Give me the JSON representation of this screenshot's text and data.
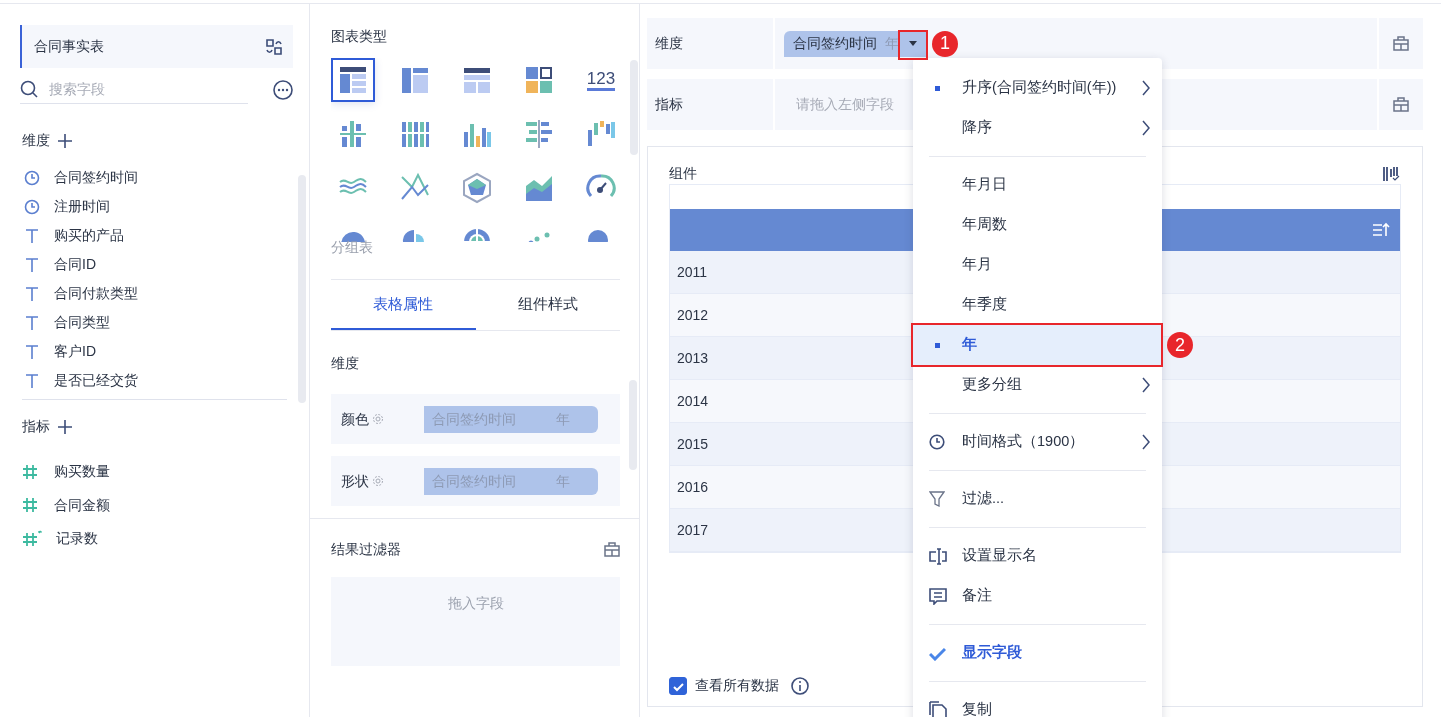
{
  "fields_panel": {
    "table_name": "合同事实表",
    "search": {
      "placeholder": "搜索字段"
    },
    "dimensions_title": "维度",
    "dimension_fields": [
      {
        "name": "合同签约时间",
        "kind": "time"
      },
      {
        "name": "注册时间",
        "kind": "time"
      },
      {
        "name": "购买的产品",
        "kind": "text"
      },
      {
        "name": "合同ID",
        "kind": "text"
      },
      {
        "name": "合同付款类型",
        "kind": "text"
      },
      {
        "name": "合同类型",
        "kind": "text"
      },
      {
        "name": "客户ID",
        "kind": "text"
      },
      {
        "name": "是否已经交货",
        "kind": "text"
      }
    ],
    "measures_title": "指标",
    "measure_fields": [
      {
        "name": "购买数量",
        "kind": "number"
      },
      {
        "name": "合同金额",
        "kind": "number"
      },
      {
        "name": "记录数",
        "kind": "count"
      }
    ]
  },
  "chart_panel": {
    "title": "图表类型",
    "chart_types": [
      {
        "kind": "grouped-table",
        "selected": true
      },
      {
        "kind": "cross-table",
        "selected": false
      },
      {
        "kind": "detail-table",
        "selected": false
      },
      {
        "kind": "tile-grid",
        "selected": false
      },
      {
        "kind": "number",
        "label": "123",
        "selected": false
      },
      {
        "kind": "grouped-bar",
        "selected": false
      },
      {
        "kind": "stacked-column",
        "selected": false
      },
      {
        "kind": "column",
        "selected": false
      },
      {
        "kind": "bar",
        "selected": false
      },
      {
        "kind": "waterfall",
        "selected": false
      },
      {
        "kind": "line",
        "selected": false
      },
      {
        "kind": "cross-line",
        "selected": false
      },
      {
        "kind": "radar",
        "selected": false
      },
      {
        "kind": "area",
        "selected": false
      },
      {
        "kind": "gauge",
        "selected": false
      },
      {
        "kind": "pie",
        "selected": false
      },
      {
        "kind": "rose",
        "selected": false
      },
      {
        "kind": "sunburst",
        "selected": false
      },
      {
        "kind": "scatter",
        "selected": false
      },
      {
        "kind": "bubble",
        "selected": false
      }
    ],
    "caption": "分组表",
    "tabs": [
      {
        "label": "表格属性",
        "selected": true
      },
      {
        "label": "组件样式",
        "selected": false
      }
    ],
    "section_title": "维度",
    "attributes": [
      {
        "label": "颜色",
        "field": "合同签约时间",
        "unit": "年"
      },
      {
        "label": "形状",
        "field": "合同签约时间",
        "unit": "年"
      }
    ],
    "filter": {
      "title": "结果过滤器",
      "placeholder": "拖入字段"
    }
  },
  "editor": {
    "dimension": {
      "label": "维度",
      "field": "合同签约时间",
      "unit": "年"
    },
    "indicator": {
      "label": "指标",
      "placeholder": "请拖入左侧字段"
    },
    "component": {
      "title": "组件",
      "rows": [
        "2011",
        "2012",
        "2013",
        "2014",
        "2015",
        "2016",
        "2017"
      ],
      "view_all": {
        "label": "查看所有数据",
        "checked": true
      }
    }
  },
  "menu": {
    "items": [
      {
        "kind": "plain",
        "label": "升序(合同签约时间(年))",
        "selected": true,
        "highlighted": false,
        "submenu": true
      },
      {
        "kind": "plain",
        "label": "降序",
        "selected": false,
        "highlighted": false,
        "submenu": true
      },
      {
        "kind": "divider"
      },
      {
        "kind": "plain",
        "label": "年月日",
        "selected": false,
        "highlighted": false,
        "submenu": false
      },
      {
        "kind": "plain",
        "label": "年周数",
        "selected": false,
        "highlighted": false,
        "submenu": false
      },
      {
        "kind": "plain",
        "label": "年月",
        "selected": false,
        "highlighted": false,
        "submenu": false
      },
      {
        "kind": "plain",
        "label": "年季度",
        "selected": false,
        "highlighted": false,
        "submenu": false
      },
      {
        "kind": "plain",
        "label": "年",
        "selected": true,
        "highlighted": true,
        "submenu": false
      },
      {
        "kind": "plain",
        "label": "更多分组",
        "selected": false,
        "highlighted": false,
        "submenu": true
      },
      {
        "kind": "divider"
      },
      {
        "kind": "clock",
        "label": "时间格式（1900）",
        "selected": false,
        "highlighted": false,
        "submenu": true
      },
      {
        "kind": "divider"
      },
      {
        "kind": "filter",
        "label": "过滤...",
        "selected": false,
        "highlighted": false,
        "submenu": false
      },
      {
        "kind": "divider"
      },
      {
        "kind": "rename",
        "label": "设置显示名",
        "selected": false,
        "highlighted": false,
        "submenu": false
      },
      {
        "kind": "note",
        "label": "备注",
        "selected": false,
        "highlighted": false,
        "submenu": false
      },
      {
        "kind": "divider"
      },
      {
        "kind": "plain",
        "label": "显示字段",
        "checked": true,
        "selected": false,
        "highlighted": false,
        "submenu": false
      },
      {
        "kind": "divider"
      },
      {
        "kind": "copy",
        "label": "复制",
        "selected": false,
        "highlighted": false,
        "submenu": false
      }
    ]
  },
  "annotations": [
    {
      "label": "1"
    },
    {
      "label": "2"
    }
  ]
}
